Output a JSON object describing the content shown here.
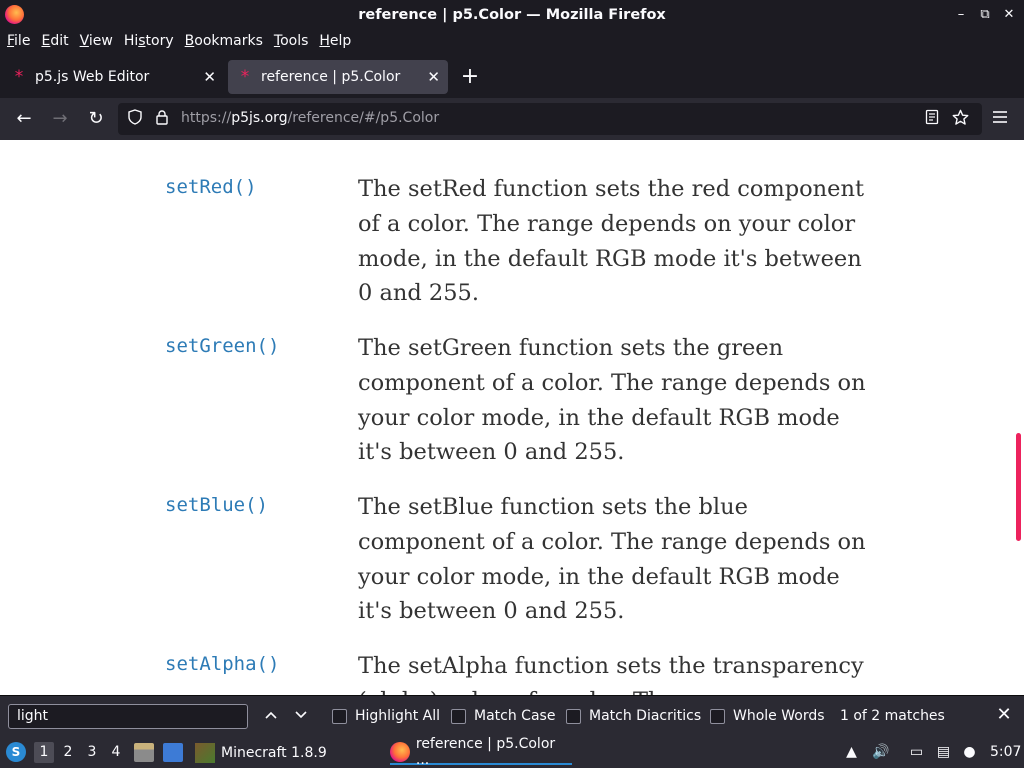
{
  "window": {
    "title": "reference | p5.Color — Mozilla Firefox",
    "min": "–",
    "restore": "⧉",
    "close": "✕"
  },
  "menu": {
    "items": [
      {
        "u": "F",
        "rest": "ile"
      },
      {
        "u": "E",
        "rest": "dit"
      },
      {
        "u": "V",
        "rest": "iew"
      },
      {
        "pre": "Hi",
        "u": "s",
        "rest": "tory"
      },
      {
        "u": "B",
        "rest": "ookmarks"
      },
      {
        "u": "T",
        "rest": "ools"
      },
      {
        "u": "H",
        "rest": "elp"
      }
    ]
  },
  "tabs": [
    {
      "label": "p5.js Web Editor",
      "active": false,
      "favicon": "*"
    },
    {
      "label": "reference | p5.Color",
      "active": true,
      "favicon": "*"
    }
  ],
  "nav": {
    "back": "←",
    "forward": "→",
    "reload": "↻",
    "url_scheme": "https://",
    "url_host": "p5js.org",
    "url_path": "/reference/#/p5.Color"
  },
  "content": {
    "entries": [
      {
        "name": "setRed()",
        "desc": "The setRed function sets the red component of a color. The range depends on your color mode, in the default RGB mode it's between 0 and 255."
      },
      {
        "name": "setGreen()",
        "desc": "The setGreen function sets the green component of a color. The range depends on your color mode, in the default RGB mode it's between 0 and 255."
      },
      {
        "name": "setBlue()",
        "desc": "The setBlue function sets the blue component of a color. The range depends on your color mode, in the default RGB mode it's between 0 and 255."
      },
      {
        "name": "setAlpha()",
        "desc": "The setAlpha function sets the transparency (alpha) value of a color. The"
      }
    ]
  },
  "findbar": {
    "query": "light",
    "highlight_all": "Highlight All",
    "match_case": "Match Case",
    "match_diacritics": "Match Diacritics",
    "whole_words": "Whole Words",
    "status": "1 of 2 matches"
  },
  "taskbar": {
    "workspaces": [
      "1",
      "2",
      "3",
      "4"
    ],
    "active_workspace": "1",
    "tasks": [
      {
        "label": "Minecraft 1.8.9"
      },
      {
        "label": "reference | p5.Color ..."
      }
    ],
    "clock": "5:07"
  },
  "colors": {
    "accent": "#ed225d",
    "link": "#2d7bb6",
    "chrome_dark": "#1c1b22",
    "chrome_mid": "#2b2a33"
  }
}
